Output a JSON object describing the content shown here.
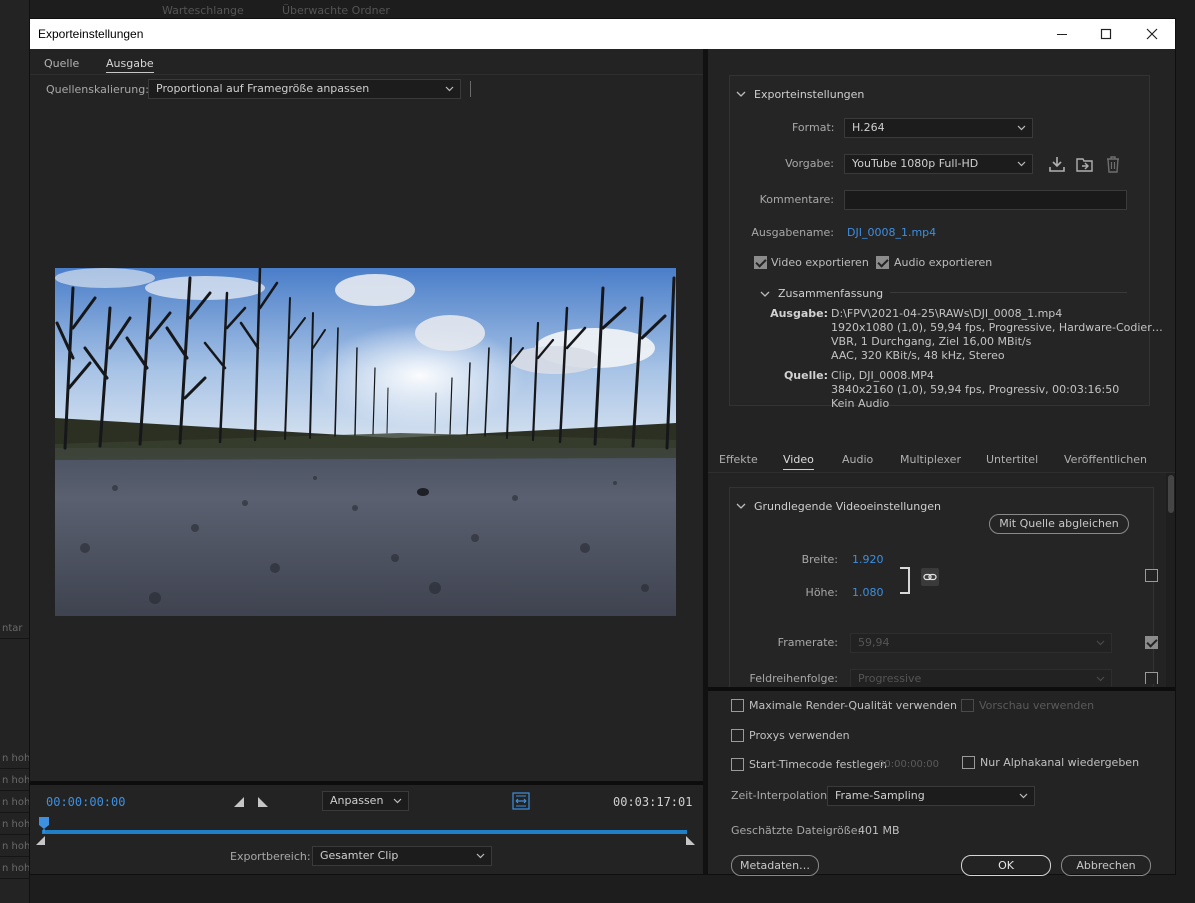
{
  "background": {
    "tabs": [
      "Warteschlange",
      "Überwachte Ordner"
    ],
    "left_fragments": [
      "ntar",
      "n hohe",
      "n hohe",
      "n hohe",
      "n hohe",
      "n hohe",
      "n hohe"
    ]
  },
  "window": {
    "title": "Exporteinstellungen",
    "minimize": "—",
    "maximize": "☐",
    "close": "✕"
  },
  "left": {
    "tabs": [
      {
        "label": "Quelle",
        "active": false
      },
      {
        "label": "Ausgabe",
        "active": true
      }
    ],
    "scaling_label": "Quellenskalierung:",
    "scaling_value": "Proportional auf Framegröße anpassen",
    "timecode_start": "00:00:00:00",
    "timecode_end": "00:03:17:01",
    "zoom_value": "Anpassen",
    "export_range_label": "Exportbereich:",
    "export_range_value": "Gesamter Clip"
  },
  "export_settings": {
    "section_title": "Exporteinstellungen",
    "format_label": "Format:",
    "format_value": "H.264",
    "preset_label": "Vorgabe:",
    "preset_value": "YouTube 1080p Full-HD",
    "comments_label": "Kommentare:",
    "comments_value": "",
    "output_name_label": "Ausgabename:",
    "output_name_value": "DJI_0008_1.mp4",
    "export_video_label": "Video exportieren",
    "export_video": true,
    "export_audio_label": "Audio exportieren",
    "export_audio": true
  },
  "summary": {
    "title": "Zusammenfassung",
    "output_label": "Ausgabe:",
    "output_lines": [
      "D:\\FPV\\2021-04-25\\RAWs\\DJI_0008_1.mp4",
      "1920x1080 (1,0), 59,94 fps, Progressive, Hardware-Codier…",
      "VBR, 1 Durchgang, Ziel 16,00 MBit/s",
      "AAC, 320 KBit/s, 48 kHz, Stereo"
    ],
    "source_label": "Quelle:",
    "source_lines": [
      "Clip, DJI_0008.MP4",
      "3840x2160 (1,0), 59,94 fps, Progressiv, 00:03:16:50",
      "Kein Audio"
    ]
  },
  "settings_tabs": [
    {
      "label": "Effekte",
      "active": false
    },
    {
      "label": "Video",
      "active": true
    },
    {
      "label": "Audio",
      "active": false
    },
    {
      "label": "Multiplexer",
      "active": false
    },
    {
      "label": "Untertitel",
      "active": false
    },
    {
      "label": "Veröffentlichen",
      "active": false
    }
  ],
  "video": {
    "section_title": "Grundlegende Videoeinstellungen",
    "match_source_label": "Mit Quelle abgleichen",
    "width_label": "Breite:",
    "width_value": "1.920",
    "height_label": "Höhe:",
    "height_value": "1.080",
    "framerate_label": "Framerate:",
    "framerate_value": "59,94",
    "field_order_label": "Feldreihenfolge:",
    "field_order_value": "Progressive"
  },
  "bottom": {
    "max_render_label": "Maximale Render-Qualität verwenden",
    "preview_label": "Vorschau verwenden",
    "proxies_label": "Proxys verwenden",
    "start_tc_label": "Start-Timecode festlegen",
    "start_tc_value": "00:00:00:00",
    "alpha_label": "Nur Alphakanal wiedergeben",
    "time_interp_label": "Zeit-Interpolation:",
    "time_interp_value": "Frame-Sampling",
    "filesize_label": "Geschätzte Dateigröße:",
    "filesize_value": "401 MB",
    "metadata_label": "Metadaten…",
    "ok_label": "OK",
    "cancel_label": "Abbrechen"
  },
  "colors": {
    "accent": "#3d8fe0",
    "panel": "#232323",
    "timeline": "#1f7fc7"
  }
}
